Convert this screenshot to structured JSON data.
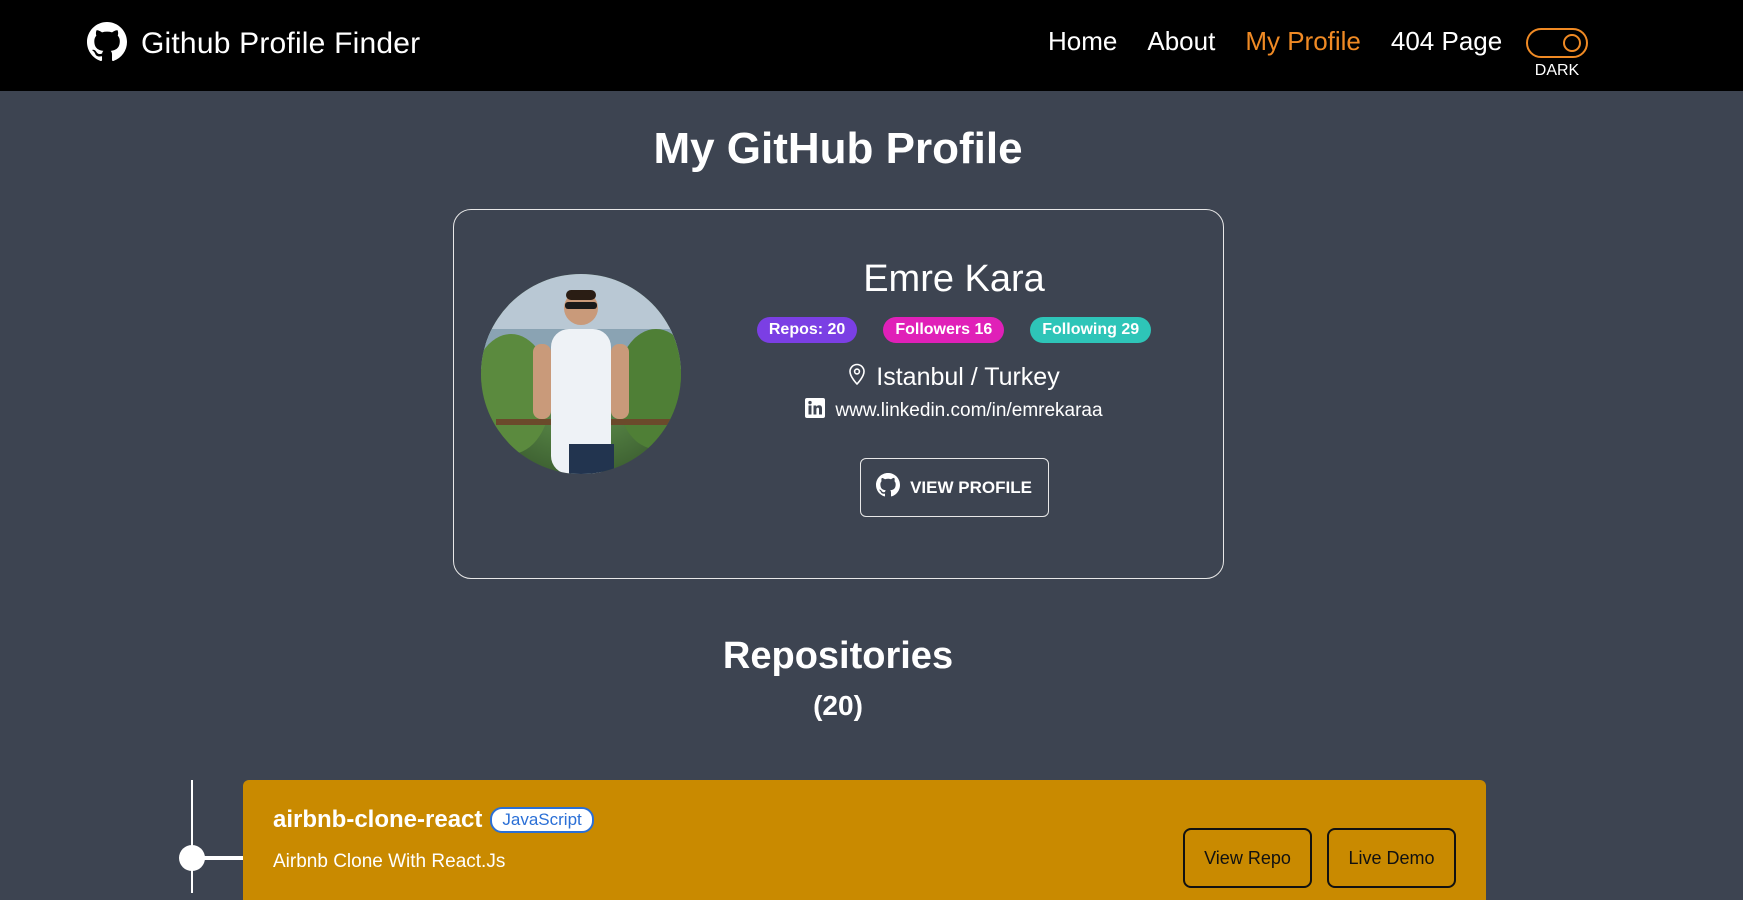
{
  "navbar": {
    "brand": "Github Profile Finder",
    "links": [
      {
        "label": "Home",
        "active": false
      },
      {
        "label": "About",
        "active": false
      },
      {
        "label": "My Profile",
        "active": true
      },
      {
        "label": "404 Page",
        "active": false
      }
    ],
    "theme_toggle_label": "DARK"
  },
  "page": {
    "title": "My GitHub Profile"
  },
  "profile": {
    "name": "Emre Kara",
    "badges": {
      "repos": "Repos: 20",
      "followers": "Followers 16",
      "following": "Following 29"
    },
    "location": "Istanbul / Turkey",
    "linkedin": "www.linkedin.com/in/emrekaraa",
    "view_profile_label": "VIEW PROFILE"
  },
  "repositories": {
    "title": "Repositories",
    "count": "(20)",
    "items": [
      {
        "name": "airbnb-clone-react",
        "language": "JavaScript",
        "description": "Airbnb Clone With React.Js",
        "view_repo_label": "View Repo",
        "live_demo_label": "Live Demo"
      }
    ]
  },
  "colors": {
    "navbar_bg": "#000000",
    "page_bg": "#3d4451",
    "accent": "#f08a24",
    "repo_card_bg": "#c98a00",
    "badge_repos": "#7b3fe4",
    "badge_followers": "#e020b8",
    "badge_following": "#2ec5b8",
    "lang_badge": "#2a6fd6"
  }
}
